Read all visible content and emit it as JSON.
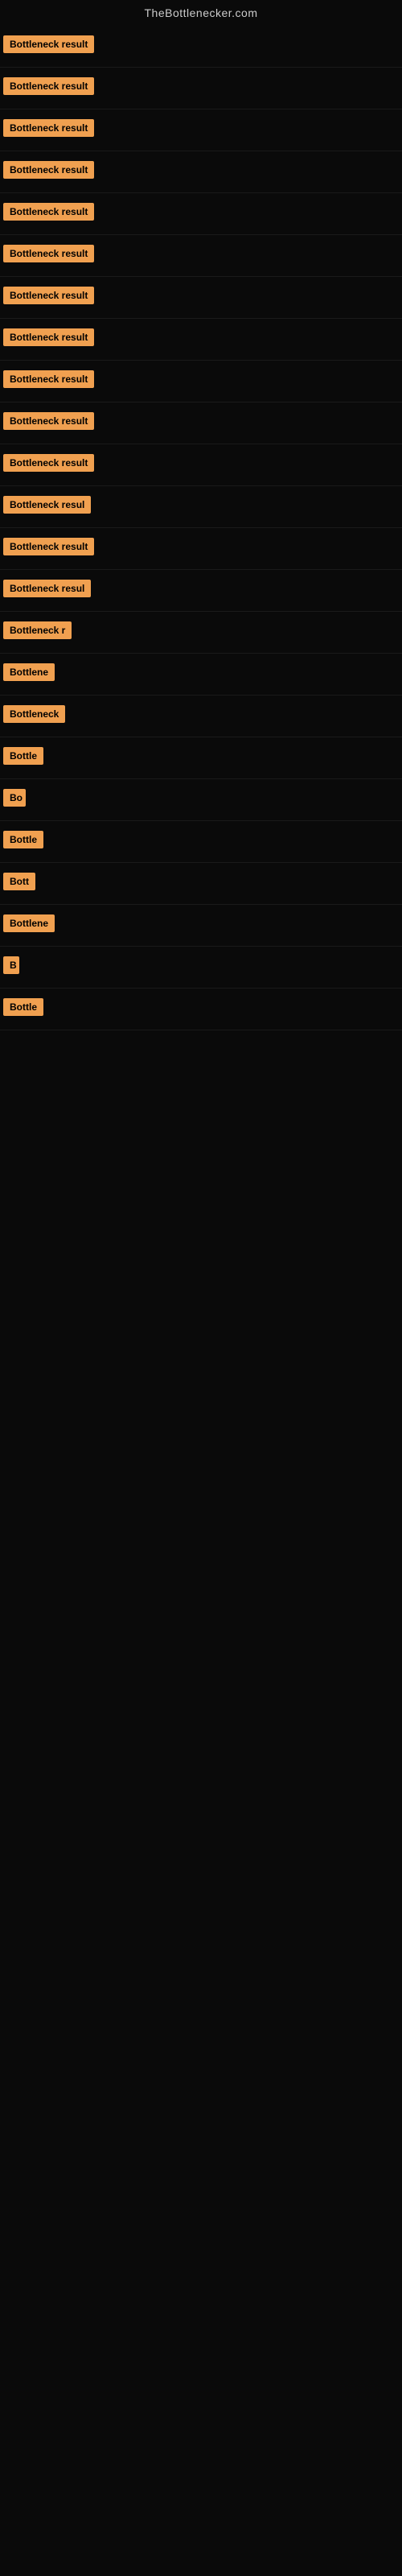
{
  "site": {
    "title": "TheBottlenecker.com"
  },
  "rows": [
    {
      "id": 1,
      "badge": "Bottleneck result",
      "width": 130
    },
    {
      "id": 2,
      "badge": "Bottleneck result",
      "width": 130
    },
    {
      "id": 3,
      "badge": "Bottleneck result",
      "width": 130
    },
    {
      "id": 4,
      "badge": "Bottleneck result",
      "width": 130
    },
    {
      "id": 5,
      "badge": "Bottleneck result",
      "width": 130
    },
    {
      "id": 6,
      "badge": "Bottleneck result",
      "width": 130
    },
    {
      "id": 7,
      "badge": "Bottleneck result",
      "width": 130
    },
    {
      "id": 8,
      "badge": "Bottleneck result",
      "width": 130
    },
    {
      "id": 9,
      "badge": "Bottleneck result",
      "width": 130
    },
    {
      "id": 10,
      "badge": "Bottleneck result",
      "width": 130
    },
    {
      "id": 11,
      "badge": "Bottleneck result",
      "width": 130
    },
    {
      "id": 12,
      "badge": "Bottleneck resul",
      "width": 118
    },
    {
      "id": 13,
      "badge": "Bottleneck result",
      "width": 130
    },
    {
      "id": 14,
      "badge": "Bottleneck resul",
      "width": 118
    },
    {
      "id": 15,
      "badge": "Bottleneck r",
      "width": 90
    },
    {
      "id": 16,
      "badge": "Bottlene",
      "width": 72
    },
    {
      "id": 17,
      "badge": "Bottleneck",
      "width": 80
    },
    {
      "id": 18,
      "badge": "Bottle",
      "width": 56
    },
    {
      "id": 19,
      "badge": "Bo",
      "width": 28
    },
    {
      "id": 20,
      "badge": "Bottle",
      "width": 56
    },
    {
      "id": 21,
      "badge": "Bott",
      "width": 42
    },
    {
      "id": 22,
      "badge": "Bottlene",
      "width": 72
    },
    {
      "id": 23,
      "badge": "B",
      "width": 20
    },
    {
      "id": 24,
      "badge": "Bottle",
      "width": 56
    }
  ]
}
